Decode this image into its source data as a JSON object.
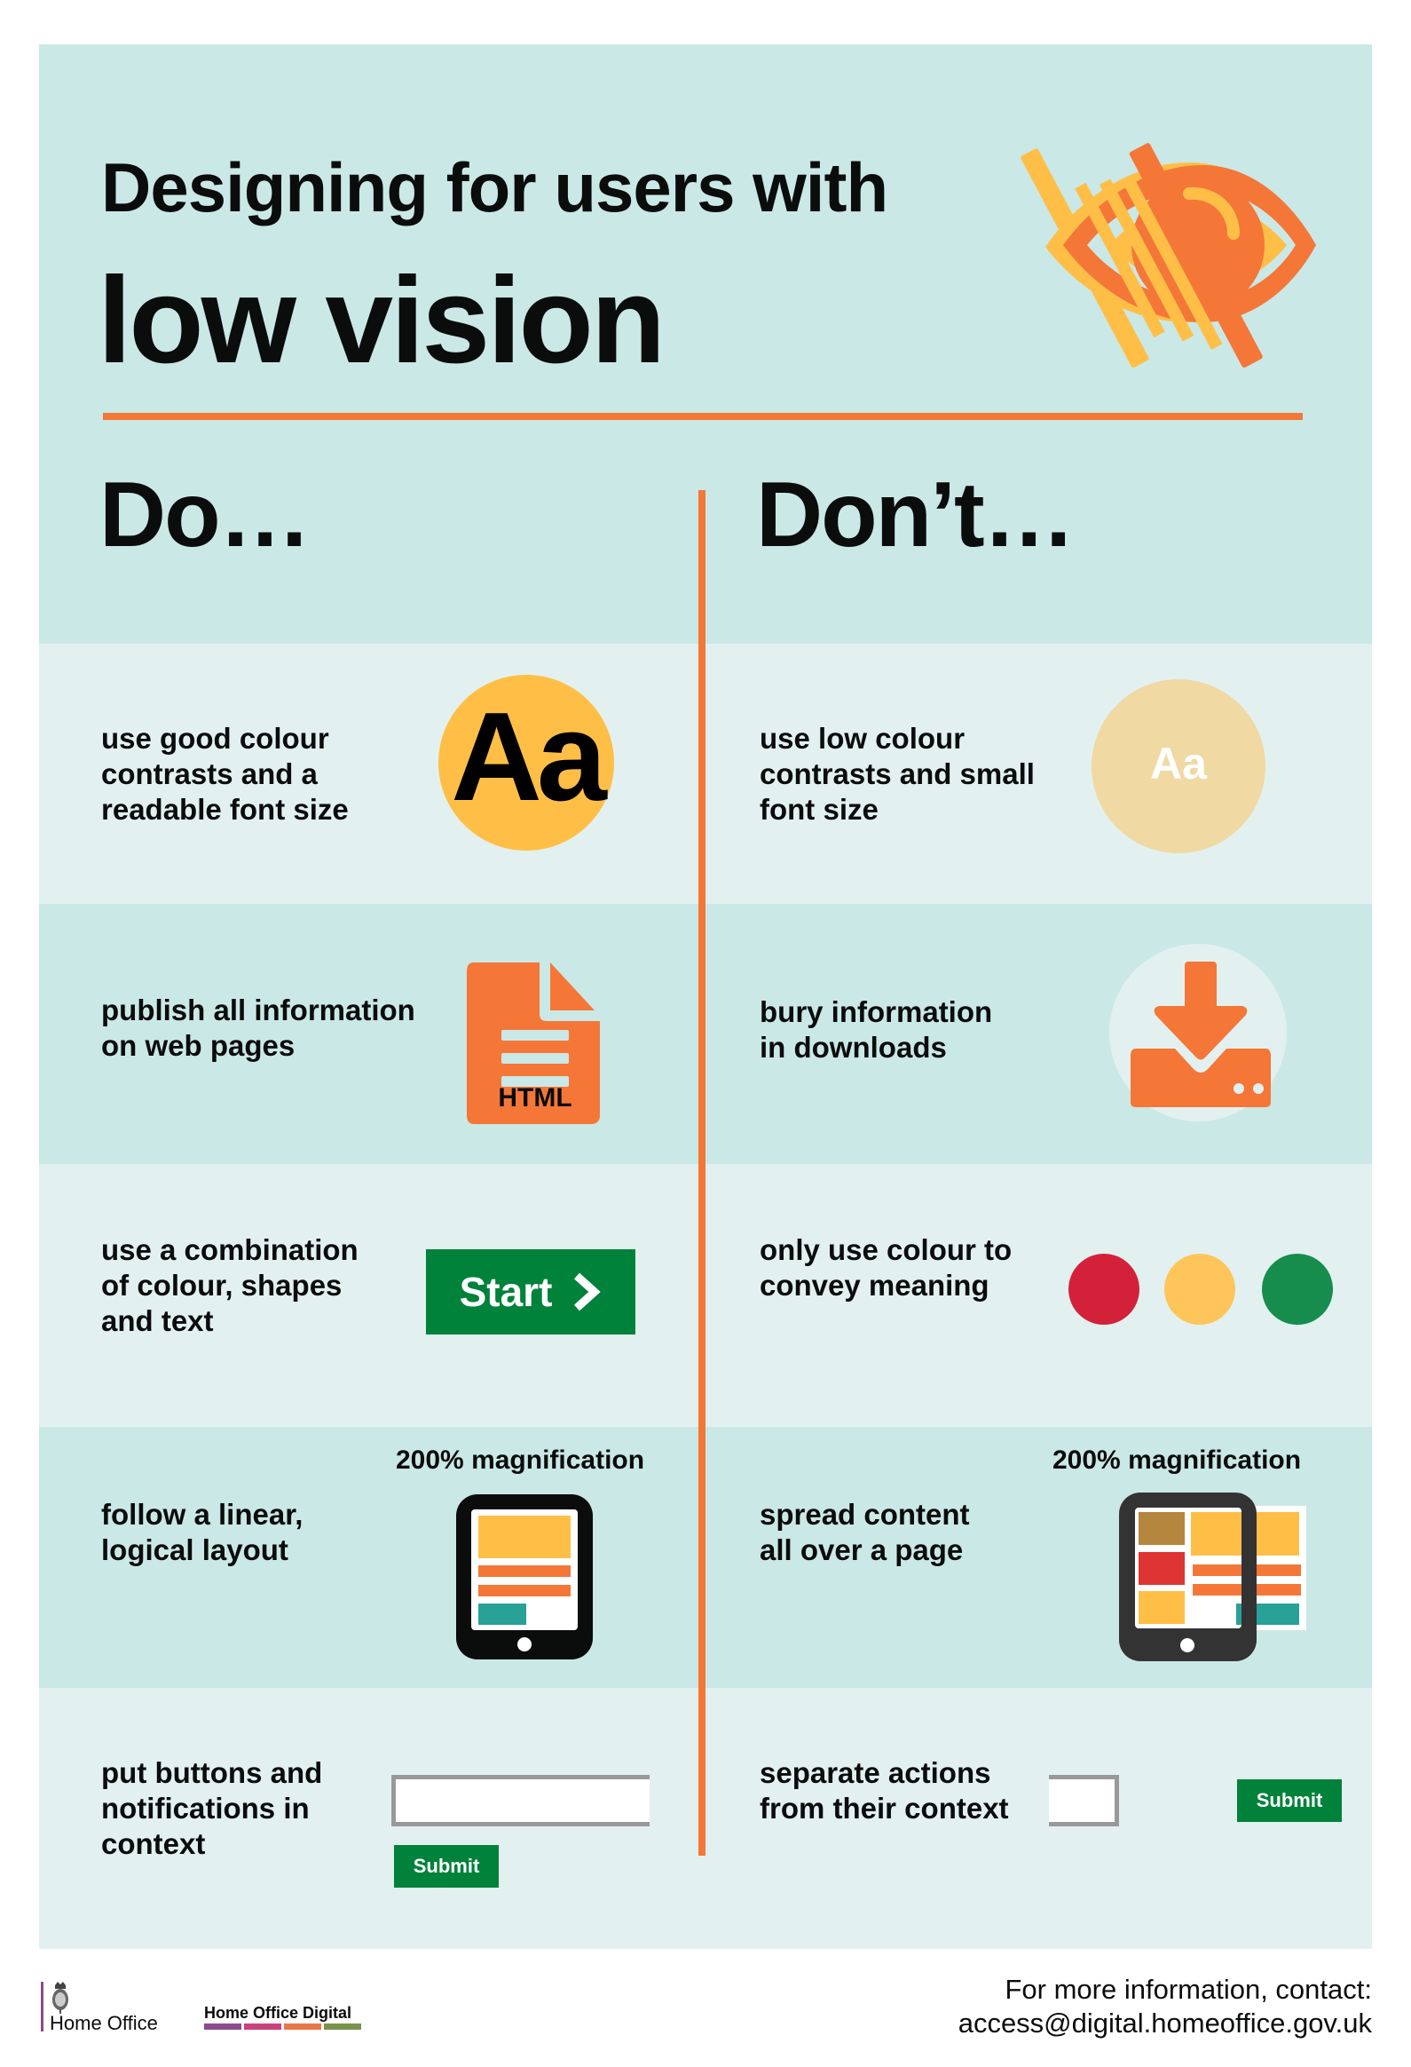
{
  "header": {
    "title_line1": "Designing for users with",
    "title_line2": "low vision",
    "icon": "low-vision-eye-icon"
  },
  "columns": {
    "do_heading": "Do…",
    "dont_heading": "Don’t…"
  },
  "rows": [
    {
      "do": {
        "text": "use good colour\ncontrasts and a\nreadable font size",
        "icon": "high-contrast-text-icon",
        "icon_label": "Aa"
      },
      "dont": {
        "text": "use low colour\ncontrasts and small\nfont size",
        "icon": "low-contrast-text-icon",
        "icon_label": "Aa"
      }
    },
    {
      "do": {
        "text": "publish all information\non web pages",
        "icon": "html-document-icon",
        "icon_label": "HTML"
      },
      "dont": {
        "text": "bury information\nin downloads",
        "icon": "download-icon"
      }
    },
    {
      "do": {
        "text": "use a combination\nof colour, shapes\nand text",
        "button_label": "Start",
        "button_icon": "chevron-right-icon"
      },
      "dont": {
        "text": "only use colour to\nconvey meaning",
        "dots": [
          "red",
          "amber",
          "green"
        ]
      }
    },
    {
      "do": {
        "text": "follow a linear,\nlogical layout",
        "caption": "200% magnification",
        "icon": "tablet-linear-layout-icon"
      },
      "dont": {
        "text": "spread content\nall over a page",
        "caption": "200% magnification",
        "icon": "tablet-spread-layout-icon"
      }
    },
    {
      "do": {
        "text": "put buttons and\nnotifications in\ncontext",
        "input_value": "",
        "button_label": "Submit"
      },
      "dont": {
        "text": "separate actions\nfrom their context",
        "input_value": "",
        "button_label": "Submit"
      }
    }
  ],
  "colors": {
    "panel": "#cae8e6",
    "panel_light": "#e2f1f0",
    "accent_orange": "#f47738",
    "yellow": "#ffbf47",
    "pale_yellow": "#f0d9a3",
    "green": "#00823b",
    "red": "#d4213a",
    "traffic_green": "#168c4d"
  },
  "footer": {
    "home_office_logo": "Home Office",
    "hod_logo": "Home Office Digital",
    "hod_stripes": [
      "#8b4a8c",
      "#c9427a",
      "#e8784a",
      "#7a9249"
    ],
    "contact_line1": "For more information, contact:",
    "contact_line2": "access@digital.homeoffice.gov.uk"
  }
}
